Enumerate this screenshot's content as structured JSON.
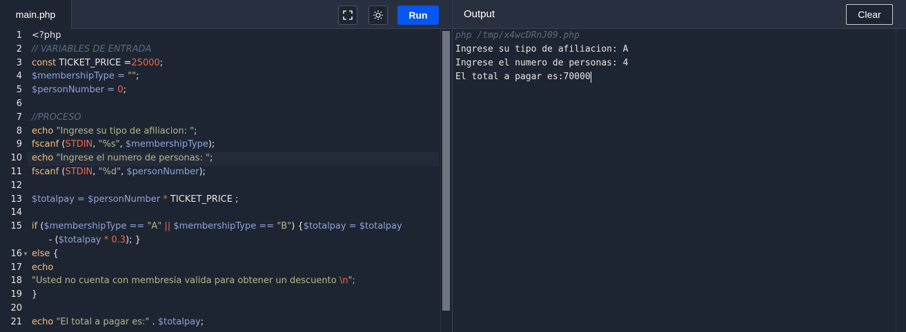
{
  "editor": {
    "file_tab": "main.php",
    "run_label": "Run",
    "fullscreen_icon": "fullscreen-icon",
    "theme_icon": "sun-icon",
    "line_numbers": [
      "1",
      "2",
      "3",
      "4",
      "5",
      "6",
      "7",
      "8",
      "9",
      "10",
      "11",
      "12",
      "13",
      "14",
      "15",
      "",
      "16",
      "17",
      "18",
      "19",
      "20",
      "21"
    ],
    "code": {
      "l1": "<?php",
      "l2": "// VARIABLES DE ENTRADA",
      "l3_kw": "const",
      "l3_const": " TICKET_PRICE =",
      "l3_num": "25000",
      "l3_end": ";",
      "l4_var": "$membershipType",
      "l4_op": " = ",
      "l4_str": "\"\"",
      "l4_end": ";",
      "l5_var": "$personNumber",
      "l5_op": " = ",
      "l5_num": "0",
      "l5_end": ";",
      "l7": "//PROCESO",
      "l8_kw": "echo",
      "l8_str": " \"Ingrese su tipo de afiliacion: \"",
      "l8_end": ";",
      "l9_kw": "fscanf",
      "l9_p1": " (",
      "l9_cs": "STDIN",
      "l9_c1": ", ",
      "l9_str": "\"%s\"",
      "l9_c2": ", ",
      "l9_var": "$membershipType",
      "l9_end": ");",
      "l10_kw": "echo",
      "l10_str": " \"Ingrese el numero de personas: \"",
      "l10_end": ";",
      "l11_kw": "fscanf",
      "l11_p1": " (",
      "l11_cs": "STDIN",
      "l11_c1": ", ",
      "l11_str": "\"%d\"",
      "l11_c2": ", ",
      "l11_var": "$personNumber",
      "l11_end": ");",
      "l13_var1": "$totalpay",
      "l13_op1": " = ",
      "l13_var2": "$personNumber",
      "l13_op2": " * ",
      "l13_const": "TICKET_PRICE ;",
      "l15_kw": "if",
      "l15_p1": " (",
      "l15_var1": "$membershipType",
      "l15_op1": " == ",
      "l15_str1": "\"A\"",
      "l15_or": " || ",
      "l15_var2": "$membershipType",
      "l15_op2": " == ",
      "l15_str2": "\"B\"",
      "l15_p2": ") {",
      "l15_var3": "$totalpay",
      "l15_op3": " = ",
      "l15_var4": "$totalpay",
      "l15b_pre": "      - (",
      "l15b_var": "$totalpay",
      "l15b_op": " * ",
      "l15b_num": "0.3",
      "l15b_end": "); }",
      "l16_kw": "else",
      "l16_end": " {",
      "l17_kw": "echo",
      "l18_str": "\"Usted no cuenta con membresia valida para obtener un descuento ",
      "l18_esc": "\\n",
      "l18_end": "\";",
      "l19": "}",
      "l21_kw": "echo",
      "l21_str": " \"El total a pagar es:\"",
      "l21_op": " . ",
      "l21_var": "$totalpay",
      "l21_end": ";"
    }
  },
  "output": {
    "title": "Output",
    "clear_label": "Clear",
    "command": "php /tmp/x4wcDRnJ09.php",
    "lines": [
      "Ingrese su tipo de afiliacion: A",
      "Ingrese el numero de personas: 4",
      "El total a pagar es:70000"
    ]
  },
  "colors": {
    "background": "#1d2432",
    "header": "#28303f",
    "run_button": "#0556f3",
    "keyword": "#f5c07a",
    "variable": "#8fa5d6",
    "string": "#b5b989",
    "number": "#f1684a",
    "comment": "#5f6b80"
  }
}
